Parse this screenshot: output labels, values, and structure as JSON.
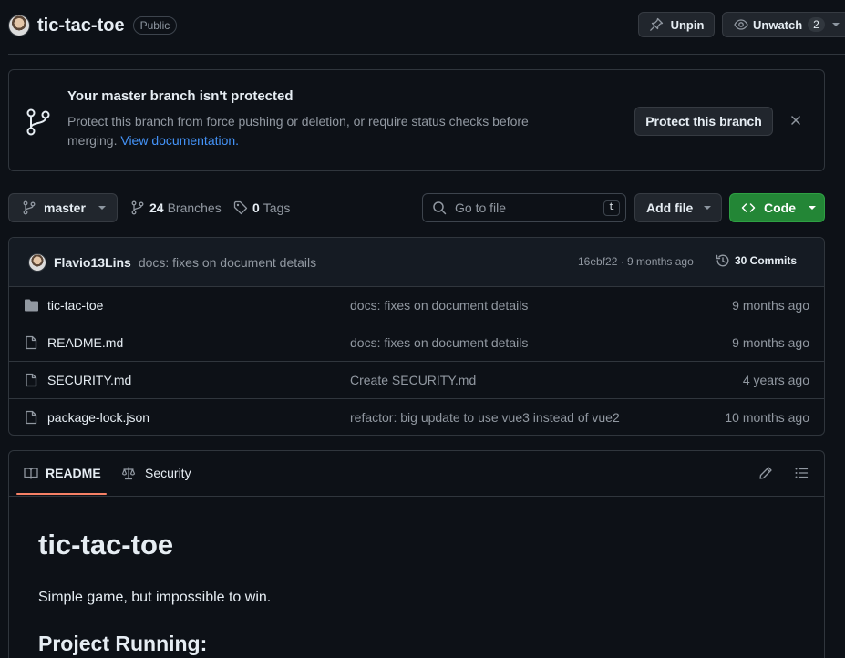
{
  "repo": {
    "name": "tic-tac-toe",
    "visibility": "Public",
    "unpin_label": "Unpin",
    "unwatch_label": "Unwatch",
    "watch_count": "2"
  },
  "banner": {
    "title": "Your master branch isn't protected",
    "text": "Protect this branch from force pushing or deletion, or require status checks before merging.",
    "link": "View documentation.",
    "button": "Protect this branch"
  },
  "toolbar": {
    "branch": "master",
    "branches_count": "24",
    "branches_label": "Branches",
    "tags_count": "0",
    "tags_label": "Tags",
    "search_placeholder": "Go to file",
    "search_shortcut": "t",
    "add_file_label": "Add file",
    "code_label": "Code"
  },
  "latest_commit": {
    "author": "Flavio13Lins",
    "message": "docs: fixes on document details",
    "hash_time": "16ebf22 · 9 months ago",
    "commits_label": "30 Commits"
  },
  "files": [
    {
      "name": "tic-tac-toe",
      "type": "folder",
      "message": "docs: fixes on document details",
      "date": "9 months ago"
    },
    {
      "name": "README.md",
      "type": "file",
      "message": "docs: fixes on document details",
      "date": "9 months ago"
    },
    {
      "name": "SECURITY.md",
      "type": "file",
      "message": "Create SECURITY.md",
      "date": "4 years ago"
    },
    {
      "name": "package-lock.json",
      "type": "file",
      "message": "refactor: big update to use vue3 instead of vue2",
      "date": "10 months ago"
    }
  ],
  "readme": {
    "tab_readme": "README",
    "tab_security": "Security",
    "h1": "tic-tac-toe",
    "paragraph": "Simple game, but impossible to win.",
    "h2": "Project Running:"
  },
  "colors": {
    "background": "#0d1117",
    "border": "#30363d",
    "accent_link": "#4493f8",
    "code_button": "#238636",
    "active_tab": "#f78166"
  }
}
